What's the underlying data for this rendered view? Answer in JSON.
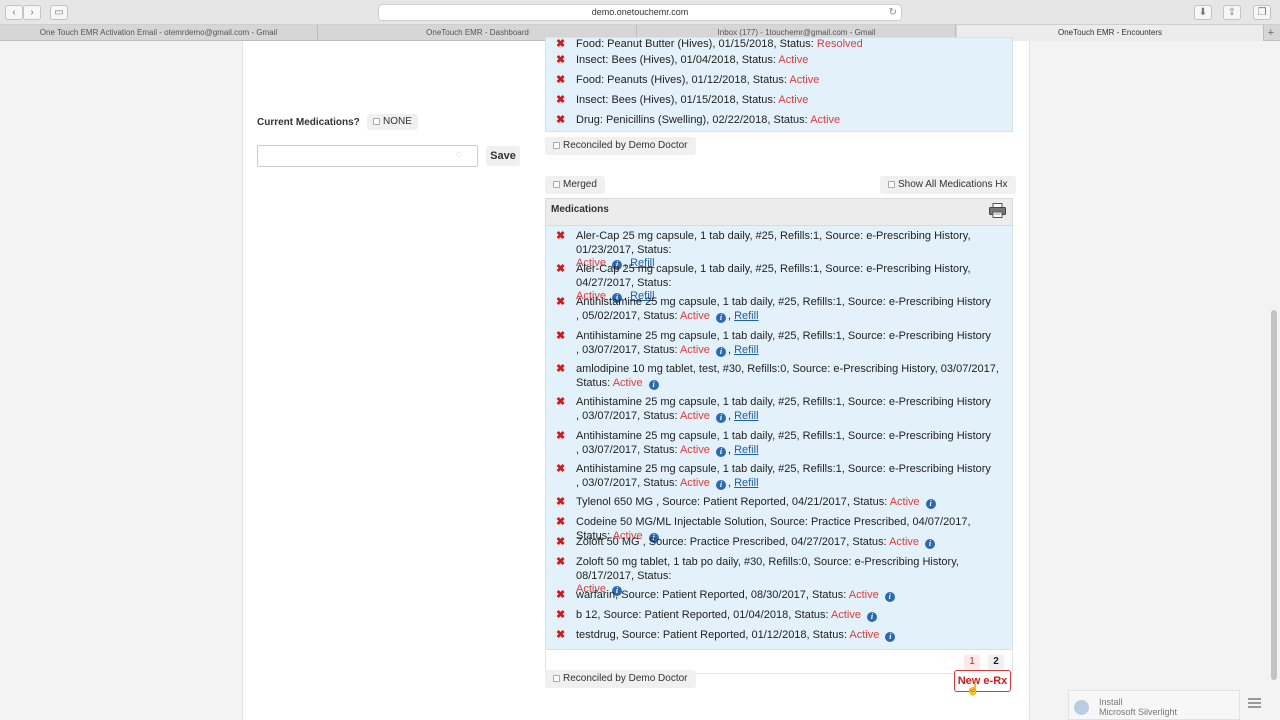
{
  "browser": {
    "url": "demo.onetouchemr.com",
    "tabs": [
      {
        "label": "One Touch EMR Activation Email - otemrdemo@gmail.com - Gmail"
      },
      {
        "label": "OneTouch EMR - Dashboard"
      },
      {
        "label": "Inbox (177) - 1touchemr@gmail.com - Gmail"
      },
      {
        "label": "OneTouch EMR - Encounters"
      }
    ],
    "new_tab": "+"
  },
  "left": {
    "current_medications_label": "Current Medications?",
    "none_label": "NONE",
    "medication_input_placeholder": "",
    "save_label": "Save"
  },
  "allergies": [
    {
      "text": "Food: Peanut Butter (Hives), 01/15/2018, Status: ",
      "status": "Resolved"
    },
    {
      "text": "Insect: Bees (Hives), 01/04/2018, Status: ",
      "status": "Active"
    },
    {
      "text": "Food: Peanuts (Hives), 01/12/2018, Status: ",
      "status": "Active"
    },
    {
      "text": "Insect: Bees (Hives), 01/15/2018, Status: ",
      "status": "Active"
    },
    {
      "text": "Drug: Penicillins (Swelling), 02/22/2018, Status: ",
      "status": "Active"
    }
  ],
  "reconciled_label": "Reconciled by Demo Doctor",
  "merged_label": "Merged",
  "show_all_label": "Show All Medications Hx",
  "medications_title": "Medications",
  "medications": [
    {
      "line1": "Aler-Cap 25 mg capsule, 1 tab daily, #25, Refills:1, Source: e-Prescribing History, 01/23/2017, Status:",
      "line2": "",
      "status": "Active",
      "refill": "Refill"
    },
    {
      "line1": "Aler-Cap 25 mg capsule, 1 tab daily, #25, Refills:1, Source: e-Prescribing History, 04/27/2017, Status:",
      "line2": "",
      "status": "Active",
      "refill": "Refill"
    },
    {
      "line1": "Antihistamine 25 mg capsule, 1 tab daily, #25, Refills:1, Source: e-Prescribing History",
      "line2": ", 05/02/2017, Status: ",
      "status": "Active",
      "refill": "Refill"
    },
    {
      "line1": "Antihistamine 25 mg capsule, 1 tab daily, #25, Refills:1, Source: e-Prescribing History",
      "line2": ", 03/07/2017, Status: ",
      "status": "Active",
      "refill": "Refill"
    },
    {
      "line1": "amlodipine 10 mg tablet, test, #30, Refills:0, Source: e-Prescribing History, 03/07/2017, Status: ",
      "line2": "",
      "status": "Active",
      "refill": ""
    },
    {
      "line1": "Antihistamine 25 mg capsule, 1 tab daily, #25, Refills:1, Source: e-Prescribing History",
      "line2": ", 03/07/2017, Status: ",
      "status": "Active",
      "refill": "Refill"
    },
    {
      "line1": "Antihistamine 25 mg capsule, 1 tab daily, #25, Refills:1, Source: e-Prescribing History",
      "line2": ", 03/07/2017, Status: ",
      "status": "Active",
      "refill": "Refill"
    },
    {
      "line1": "Antihistamine 25 mg capsule, 1 tab daily, #25, Refills:1, Source: e-Prescribing History",
      "line2": ", 03/07/2017, Status: ",
      "status": "Active",
      "refill": "Refill"
    },
    {
      "line1": "Tylenol 650 MG , Source: Patient Reported, 04/21/2017, Status: ",
      "line2": "",
      "status": "Active",
      "refill": ""
    },
    {
      "line1": "Codeine 50 MG/ML Injectable Solution, Source: Practice Prescribed, 04/07/2017, Status: ",
      "line2": "",
      "status": "Active",
      "refill": ""
    },
    {
      "line1": "Zoloft 50 MG , Source: Practice Prescribed, 04/27/2017, Status: ",
      "line2": "",
      "status": "Active",
      "refill": ""
    },
    {
      "line1": "Zoloft 50 mg tablet, 1 tab po daily, #30, Refills:0, Source: e-Prescribing History, 08/17/2017, Status:",
      "line2": "",
      "status": "Active",
      "refill": ""
    },
    {
      "line1": "warfarin, Source: Patient Reported, 08/30/2017, Status: ",
      "line2": "",
      "status": "Active",
      "refill": ""
    },
    {
      "line1": "b 12, Source: Patient Reported, 01/04/2018, Status: ",
      "line2": "",
      "status": "Active",
      "refill": ""
    },
    {
      "line1": "testdrug, Source: Patient Reported, 01/12/2018, Status: ",
      "line2": "",
      "status": "Active",
      "refill": ""
    }
  ],
  "pagination": {
    "page1": "1",
    "page2": "2"
  },
  "new_erx_label": "New e-Rx",
  "silverlight": {
    "line1": "Install",
    "line2": "Microsoft Silverlight"
  },
  "colors": {
    "active": "#e03c3c",
    "delete_x": "#d11a1a",
    "panel_bg": "#e3f1fb",
    "link": "#1f5fa8"
  }
}
